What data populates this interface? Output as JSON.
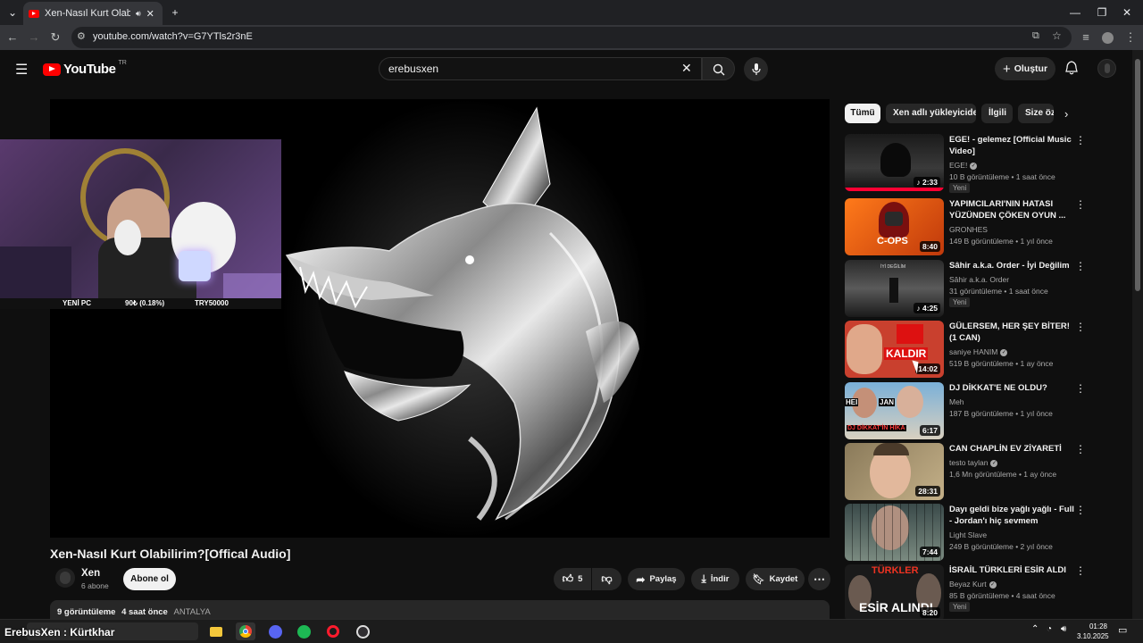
{
  "browser": {
    "tab_title": "Xen-Nasıl Kurt Olabilirim?[Offical Audio]",
    "url": "youtube.com/watch?v=G7YTls2r3nE"
  },
  "youtube": {
    "logo_text": "YouTube",
    "country_code": "TR",
    "search_value": "erebusxen",
    "create_label": "Oluştur"
  },
  "player": {
    "facecam_overlay": {
      "left": "YENİ PC",
      "middle": "90₺ (0.18%)",
      "right": "TRY50000"
    }
  },
  "video": {
    "title": "Xen-Nasıl Kurt Olabilirim?[Offical Audio]",
    "channel": "Xen",
    "subscribers": "6 abone",
    "subscribe_label": "Abone ol",
    "likes": "5",
    "share_label": "Paylaş",
    "download_label": "İndir",
    "save_label": "Kaydet",
    "views": "9 görüntüleme",
    "age": "4 saat önce",
    "location": "ANTALYA"
  },
  "chips": [
    "Tümü",
    "Xen adlı yükleyiciden",
    "İlgili",
    "Size öz"
  ],
  "recommendations": [
    {
      "title": "EGE! - gelemez [Official Music Video]",
      "channel": "EGE!",
      "verified": true,
      "meta": "10 B görüntüleme • 1 saat önce",
      "duration": "2:33",
      "badge": "Yeni",
      "music": true
    },
    {
      "title": "YAPIMCILARI'NIN HATASI YÜZÜNDEN ÇÖKEN OYUN ...",
      "channel": "GRONHES",
      "verified": false,
      "meta": "149 B görüntüleme • 1 yıl önce",
      "duration": "8:40",
      "badge": "",
      "music": false
    },
    {
      "title": "Sâhir a.k.a. Order - İyi Değilim",
      "channel": "Sâhir a.k.a. Order",
      "verified": false,
      "meta": "31 görüntüleme • 1 saat önce",
      "duration": "4:25",
      "badge": "Yeni",
      "music": true
    },
    {
      "title": "GÜLERSEM, HER ŞEY BİTER! (1 CAN)",
      "channel": "saniye HANIM",
      "verified": true,
      "meta": "519 B görüntüleme • 1 ay önce",
      "duration": "14:02",
      "badge": "",
      "music": false
    },
    {
      "title": "DJ DİKKAT'E NE OLDU?",
      "channel": "Meh",
      "verified": false,
      "meta": "187 B görüntüleme • 1 yıl önce",
      "duration": "6:17",
      "badge": "",
      "music": false
    },
    {
      "title": "CAN CHAPLİN EV ZİYARETİ",
      "channel": "testo taylan",
      "verified": true,
      "meta": "1,6 Mn görüntüleme • 1 ay önce",
      "duration": "28:31",
      "badge": "",
      "music": false
    },
    {
      "title": "Dayı geldi bize yağlı yağlı - Full - Jordan'ı hiç sevmem",
      "channel": "Light Slave",
      "verified": false,
      "meta": "249 B görüntüleme • 2 yıl önce",
      "duration": "7:44",
      "badge": "",
      "music": false
    },
    {
      "title": "İSRAİL TÜRKLERİ ESİR ALDI",
      "channel": "Beyaz Kurt",
      "verified": true,
      "meta": "85 B görüntüleme • 4 saat önce",
      "duration": "8:20",
      "badge": "Yeni",
      "music": false
    }
  ],
  "thumb_texts": {
    "cops": "C-OPS",
    "iyi": "İYİ DEĞİLİM",
    "kaldir": "KALDIR",
    "jan": "JAN",
    "hei": "HEI",
    "dj": "DJ DİKKAT'İN HİKA",
    "turkler": "TÜRKLER",
    "esir": "ESİR ALINDI"
  },
  "taskbar": {
    "overlay": "ErebusXen : Kürtkhar",
    "time": "01:28",
    "date": "3.10.2025"
  }
}
